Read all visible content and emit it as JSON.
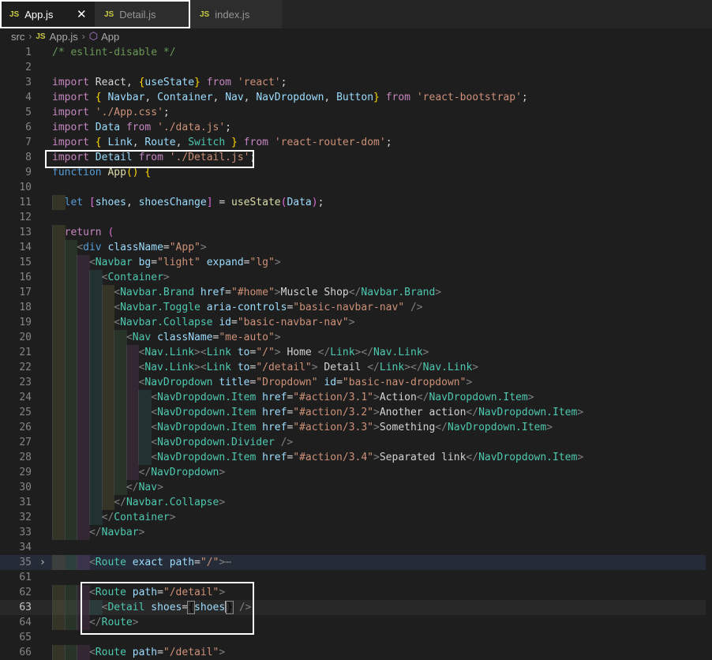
{
  "tabs": [
    {
      "icon": "JS",
      "label": "App.js",
      "close": "✕"
    },
    {
      "icon": "JS",
      "label": "Detail.js"
    },
    {
      "icon": "JS",
      "label": "index.js"
    }
  ],
  "breadcrumb": {
    "folder": "src",
    "file_icon": "JS",
    "file": "App.js",
    "symbol": "App"
  },
  "lines": [
    {
      "n": "1",
      "t": [
        [
          "c",
          "/* eslint-disable */"
        ]
      ]
    },
    {
      "n": "2",
      "t": []
    },
    {
      "n": "3",
      "t": [
        [
          "ctl",
          "import"
        ],
        [
          "p",
          " React, "
        ],
        [
          "g",
          "{"
        ],
        [
          "v",
          "useState"
        ],
        [
          "g",
          "}"
        ],
        [
          "p",
          " "
        ],
        [
          "ctl",
          "from"
        ],
        [
          "p",
          " "
        ],
        [
          "s",
          "'react'"
        ],
        [
          "p",
          ";"
        ]
      ]
    },
    {
      "n": "4",
      "t": [
        [
          "ctl",
          "import"
        ],
        [
          "p",
          " "
        ],
        [
          "g",
          "{"
        ],
        [
          "p",
          " "
        ],
        [
          "v",
          "Navbar"
        ],
        [
          "p",
          ", "
        ],
        [
          "v",
          "Container"
        ],
        [
          "p",
          ", "
        ],
        [
          "v",
          "Nav"
        ],
        [
          "p",
          ", "
        ],
        [
          "v",
          "NavDropdown"
        ],
        [
          "p",
          ", "
        ],
        [
          "v",
          "Button"
        ],
        [
          "g",
          "}"
        ],
        [
          "p",
          " "
        ],
        [
          "ctl",
          "from"
        ],
        [
          "p",
          " "
        ],
        [
          "s",
          "'react-bootstrap'"
        ],
        [
          "p",
          ";"
        ]
      ]
    },
    {
      "n": "5",
      "t": [
        [
          "ctl",
          "import"
        ],
        [
          "p",
          " "
        ],
        [
          "s",
          "'./App.css'"
        ],
        [
          "p",
          ";"
        ]
      ]
    },
    {
      "n": "6",
      "t": [
        [
          "ctl",
          "import"
        ],
        [
          "p",
          " "
        ],
        [
          "v",
          "Data"
        ],
        [
          "p",
          " "
        ],
        [
          "ctl",
          "from"
        ],
        [
          "p",
          " "
        ],
        [
          "s",
          "'./data.js'"
        ],
        [
          "p",
          ";"
        ]
      ]
    },
    {
      "n": "7",
      "t": [
        [
          "ctl",
          "import"
        ],
        [
          "p",
          " "
        ],
        [
          "g",
          "{"
        ],
        [
          "p",
          " "
        ],
        [
          "v",
          "Link"
        ],
        [
          "p",
          ", "
        ],
        [
          "v",
          "Route"
        ],
        [
          "p",
          ", "
        ],
        [
          "t",
          "Switch"
        ],
        [
          "p",
          " "
        ],
        [
          "g",
          "}"
        ],
        [
          "p",
          " "
        ],
        [
          "ctl",
          "from"
        ],
        [
          "p",
          " "
        ],
        [
          "s",
          "'react-router-dom'"
        ],
        [
          "p",
          ";"
        ]
      ]
    },
    {
      "n": "8",
      "t": [
        [
          "ctl",
          "import"
        ],
        [
          "p",
          " "
        ],
        [
          "v",
          "Detail"
        ],
        [
          "p",
          " "
        ],
        [
          "ctl",
          "from"
        ],
        [
          "p",
          " "
        ],
        [
          "s",
          "'./Detail.js'"
        ],
        [
          "p",
          ";"
        ]
      ]
    },
    {
      "n": "9",
      "t": [
        [
          "kw",
          "function"
        ],
        [
          "p",
          " "
        ],
        [
          "f",
          "App"
        ],
        [
          "g",
          "()"
        ],
        [
          "p",
          " "
        ],
        [
          "g",
          "{"
        ]
      ]
    },
    {
      "n": "10",
      "t": []
    },
    {
      "n": "11",
      "t": [
        [
          "p",
          "  "
        ],
        [
          "kw",
          "let"
        ],
        [
          "p",
          " "
        ],
        [
          "pp",
          "["
        ],
        [
          "v",
          "shoes"
        ],
        [
          "p",
          ", "
        ],
        [
          "v",
          "shoesChange"
        ],
        [
          "pp",
          "]"
        ],
        [
          "p",
          " = "
        ],
        [
          "f",
          "useState"
        ],
        [
          "pp",
          "("
        ],
        [
          "v",
          "Data"
        ],
        [
          "pp",
          ")"
        ],
        [
          "p",
          ";"
        ]
      ]
    },
    {
      "n": "12",
      "t": []
    },
    {
      "n": "13",
      "t": [
        [
          "p",
          "  "
        ],
        [
          "ctl",
          "return"
        ],
        [
          "p",
          " "
        ],
        [
          "pp",
          "("
        ]
      ]
    },
    {
      "n": "14",
      "t": [
        [
          "p",
          "    "
        ],
        [
          "tg",
          "<"
        ],
        [
          "kw",
          "div"
        ],
        [
          "p",
          " "
        ],
        [
          "at",
          "className"
        ],
        [
          "p",
          "="
        ],
        [
          "s",
          "\"App\""
        ],
        [
          "tg",
          ">"
        ]
      ]
    },
    {
      "n": "15",
      "t": [
        [
          "p",
          "      "
        ],
        [
          "tg",
          "<"
        ],
        [
          "t",
          "Navbar"
        ],
        [
          "p",
          " "
        ],
        [
          "at",
          "bg"
        ],
        [
          "p",
          "="
        ],
        [
          "s",
          "\"light\""
        ],
        [
          "p",
          " "
        ],
        [
          "at",
          "expand"
        ],
        [
          "p",
          "="
        ],
        [
          "s",
          "\"lg\""
        ],
        [
          "tg",
          ">"
        ]
      ]
    },
    {
      "n": "16",
      "t": [
        [
          "p",
          "        "
        ],
        [
          "tg",
          "<"
        ],
        [
          "t",
          "Container"
        ],
        [
          "tg",
          ">"
        ]
      ]
    },
    {
      "n": "17",
      "t": [
        [
          "p",
          "          "
        ],
        [
          "tg",
          "<"
        ],
        [
          "t",
          "Navbar.Brand"
        ],
        [
          "p",
          " "
        ],
        [
          "at",
          "href"
        ],
        [
          "p",
          "="
        ],
        [
          "s",
          "\"#home\""
        ],
        [
          "tg",
          ">"
        ],
        [
          "p",
          "Muscle Shop"
        ],
        [
          "tg",
          "</"
        ],
        [
          "t",
          "Navbar.Brand"
        ],
        [
          "tg",
          ">"
        ]
      ]
    },
    {
      "n": "18",
      "t": [
        [
          "p",
          "          "
        ],
        [
          "tg",
          "<"
        ],
        [
          "t",
          "Navbar.Toggle"
        ],
        [
          "p",
          " "
        ],
        [
          "at",
          "aria-controls"
        ],
        [
          "p",
          "="
        ],
        [
          "s",
          "\"basic-navbar-nav\""
        ],
        [
          "p",
          " "
        ],
        [
          "tg",
          "/>"
        ]
      ]
    },
    {
      "n": "19",
      "t": [
        [
          "p",
          "          "
        ],
        [
          "tg",
          "<"
        ],
        [
          "t",
          "Navbar.Collapse"
        ],
        [
          "p",
          " "
        ],
        [
          "at",
          "id"
        ],
        [
          "p",
          "="
        ],
        [
          "s",
          "\"basic-navbar-nav\""
        ],
        [
          "tg",
          ">"
        ]
      ]
    },
    {
      "n": "20",
      "t": [
        [
          "p",
          "            "
        ],
        [
          "tg",
          "<"
        ],
        [
          "t",
          "Nav"
        ],
        [
          "p",
          " "
        ],
        [
          "at",
          "className"
        ],
        [
          "p",
          "="
        ],
        [
          "s",
          "\"me-auto\""
        ],
        [
          "tg",
          ">"
        ]
      ]
    },
    {
      "n": "21",
      "t": [
        [
          "p",
          "              "
        ],
        [
          "tg",
          "<"
        ],
        [
          "t",
          "Nav.Link"
        ],
        [
          "tg",
          "><"
        ],
        [
          "t",
          "Link"
        ],
        [
          "p",
          " "
        ],
        [
          "at",
          "to"
        ],
        [
          "p",
          "="
        ],
        [
          "s",
          "\"/\""
        ],
        [
          "tg",
          ">"
        ],
        [
          "p",
          " Home "
        ],
        [
          "tg",
          "</"
        ],
        [
          "t",
          "Link"
        ],
        [
          "tg",
          "></"
        ],
        [
          "t",
          "Nav.Link"
        ],
        [
          "tg",
          ">"
        ]
      ]
    },
    {
      "n": "22",
      "t": [
        [
          "p",
          "              "
        ],
        [
          "tg",
          "<"
        ],
        [
          "t",
          "Nav.Link"
        ],
        [
          "tg",
          "><"
        ],
        [
          "t",
          "Link"
        ],
        [
          "p",
          " "
        ],
        [
          "at",
          "to"
        ],
        [
          "p",
          "="
        ],
        [
          "s",
          "\"/detail\""
        ],
        [
          "tg",
          ">"
        ],
        [
          "p",
          " Detail "
        ],
        [
          "tg",
          "</"
        ],
        [
          "t",
          "Link"
        ],
        [
          "tg",
          "></"
        ],
        [
          "t",
          "Nav.Link"
        ],
        [
          "tg",
          ">"
        ]
      ]
    },
    {
      "n": "23",
      "t": [
        [
          "p",
          "              "
        ],
        [
          "tg",
          "<"
        ],
        [
          "t",
          "NavDropdown"
        ],
        [
          "p",
          " "
        ],
        [
          "at",
          "title"
        ],
        [
          "p",
          "="
        ],
        [
          "s",
          "\"Dropdown\""
        ],
        [
          "p",
          " "
        ],
        [
          "at",
          "id"
        ],
        [
          "p",
          "="
        ],
        [
          "s",
          "\"basic-nav-dropdown\""
        ],
        [
          "tg",
          ">"
        ]
      ]
    },
    {
      "n": "24",
      "t": [
        [
          "p",
          "                "
        ],
        [
          "tg",
          "<"
        ],
        [
          "t",
          "NavDropdown.Item"
        ],
        [
          "p",
          " "
        ],
        [
          "at",
          "href"
        ],
        [
          "p",
          "="
        ],
        [
          "s",
          "\"#action/3.1\""
        ],
        [
          "tg",
          ">"
        ],
        [
          "p",
          "Action"
        ],
        [
          "tg",
          "</"
        ],
        [
          "t",
          "NavDropdown.Item"
        ],
        [
          "tg",
          ">"
        ]
      ]
    },
    {
      "n": "25",
      "t": [
        [
          "p",
          "                "
        ],
        [
          "tg",
          "<"
        ],
        [
          "t",
          "NavDropdown.Item"
        ],
        [
          "p",
          " "
        ],
        [
          "at",
          "href"
        ],
        [
          "p",
          "="
        ],
        [
          "s",
          "\"#action/3.2\""
        ],
        [
          "tg",
          ">"
        ],
        [
          "p",
          "Another action"
        ],
        [
          "tg",
          "</"
        ],
        [
          "t",
          "NavDropdown.Item"
        ],
        [
          "tg",
          ">"
        ]
      ]
    },
    {
      "n": "26",
      "t": [
        [
          "p",
          "                "
        ],
        [
          "tg",
          "<"
        ],
        [
          "t",
          "NavDropdown.Item"
        ],
        [
          "p",
          " "
        ],
        [
          "at",
          "href"
        ],
        [
          "p",
          "="
        ],
        [
          "s",
          "\"#action/3.3\""
        ],
        [
          "tg",
          ">"
        ],
        [
          "p",
          "Something"
        ],
        [
          "tg",
          "</"
        ],
        [
          "t",
          "NavDropdown.Item"
        ],
        [
          "tg",
          ">"
        ]
      ]
    },
    {
      "n": "27",
      "t": [
        [
          "p",
          "                "
        ],
        [
          "tg",
          "<"
        ],
        [
          "t",
          "NavDropdown.Divider"
        ],
        [
          "p",
          " "
        ],
        [
          "tg",
          "/>"
        ]
      ]
    },
    {
      "n": "28",
      "t": [
        [
          "p",
          "                "
        ],
        [
          "tg",
          "<"
        ],
        [
          "t",
          "NavDropdown.Item"
        ],
        [
          "p",
          " "
        ],
        [
          "at",
          "href"
        ],
        [
          "p",
          "="
        ],
        [
          "s",
          "\"#action/3.4\""
        ],
        [
          "tg",
          ">"
        ],
        [
          "p",
          "Separated link"
        ],
        [
          "tg",
          "</"
        ],
        [
          "t",
          "NavDropdown.Item"
        ],
        [
          "tg",
          ">"
        ]
      ]
    },
    {
      "n": "29",
      "t": [
        [
          "p",
          "              "
        ],
        [
          "tg",
          "</"
        ],
        [
          "t",
          "NavDropdown"
        ],
        [
          "tg",
          ">"
        ]
      ]
    },
    {
      "n": "30",
      "t": [
        [
          "p",
          "            "
        ],
        [
          "tg",
          "</"
        ],
        [
          "t",
          "Nav"
        ],
        [
          "tg",
          ">"
        ]
      ]
    },
    {
      "n": "31",
      "t": [
        [
          "p",
          "          "
        ],
        [
          "tg",
          "</"
        ],
        [
          "t",
          "Navbar.Collapse"
        ],
        [
          "tg",
          ">"
        ]
      ]
    },
    {
      "n": "32",
      "t": [
        [
          "p",
          "        "
        ],
        [
          "tg",
          "</"
        ],
        [
          "t",
          "Container"
        ],
        [
          "tg",
          ">"
        ]
      ]
    },
    {
      "n": "33",
      "t": [
        [
          "p",
          "      "
        ],
        [
          "tg",
          "</"
        ],
        [
          "t",
          "Navbar"
        ],
        [
          "tg",
          ">"
        ]
      ]
    },
    {
      "n": "34",
      "t": []
    },
    {
      "n": "35",
      "fold": true,
      "t": [
        [
          "p",
          "      "
        ],
        [
          "tg",
          "<"
        ],
        [
          "t",
          "Route"
        ],
        [
          "p",
          " "
        ],
        [
          "at",
          "exact"
        ],
        [
          "p",
          " "
        ],
        [
          "at",
          "path"
        ],
        [
          "p",
          "="
        ],
        [
          "s",
          "\"/\""
        ],
        [
          "tg",
          ">"
        ],
        [
          "ell",
          "⋯"
        ]
      ]
    },
    {
      "n": "61",
      "t": []
    },
    {
      "n": "62",
      "t": [
        [
          "p",
          "      "
        ],
        [
          "tg",
          "<"
        ],
        [
          "t",
          "Route"
        ],
        [
          "p",
          " "
        ],
        [
          "at",
          "path"
        ],
        [
          "p",
          "="
        ],
        [
          "s",
          "\"/detail\""
        ],
        [
          "tg",
          ">"
        ]
      ]
    },
    {
      "n": "63",
      "cur": true,
      "t": [
        [
          "p",
          "        "
        ],
        [
          "tg",
          "<"
        ],
        [
          "t",
          "Detail"
        ],
        [
          "p",
          " "
        ],
        [
          "at",
          "shoes"
        ],
        [
          "p",
          "="
        ],
        [
          "bm",
          "{"
        ],
        [
          "v",
          "shoes"
        ],
        [
          "cursor",
          ""
        ],
        [
          "bm",
          "}"
        ],
        [
          "p",
          " "
        ],
        [
          "tg",
          "/>"
        ]
      ]
    },
    {
      "n": "64",
      "t": [
        [
          "p",
          "      "
        ],
        [
          "tg",
          "</"
        ],
        [
          "t",
          "Route"
        ],
        [
          "tg",
          ">"
        ]
      ]
    },
    {
      "n": "65",
      "t": []
    },
    {
      "n": "66",
      "t": [
        [
          "p",
          "      "
        ],
        [
          "tg",
          "<"
        ],
        [
          "t",
          "Route"
        ],
        [
          "p",
          " "
        ],
        [
          "at",
          "path"
        ],
        [
          "p",
          "="
        ],
        [
          "s",
          "\"/detail\""
        ],
        [
          "tg",
          ">"
        ]
      ]
    }
  ],
  "colors": {
    "keyword": "#569cd6",
    "control": "#c586c0",
    "string": "#ce9178",
    "comment": "#6a9955",
    "variable": "#9cdcfe",
    "function": "#dcdcaa",
    "component": "#4ec9b0",
    "tag_bracket": "#808080",
    "brace": "#ffd700",
    "paren": "#da70d6",
    "editor_bg": "#1e1e1e",
    "highlight_box": "#ffffff"
  }
}
